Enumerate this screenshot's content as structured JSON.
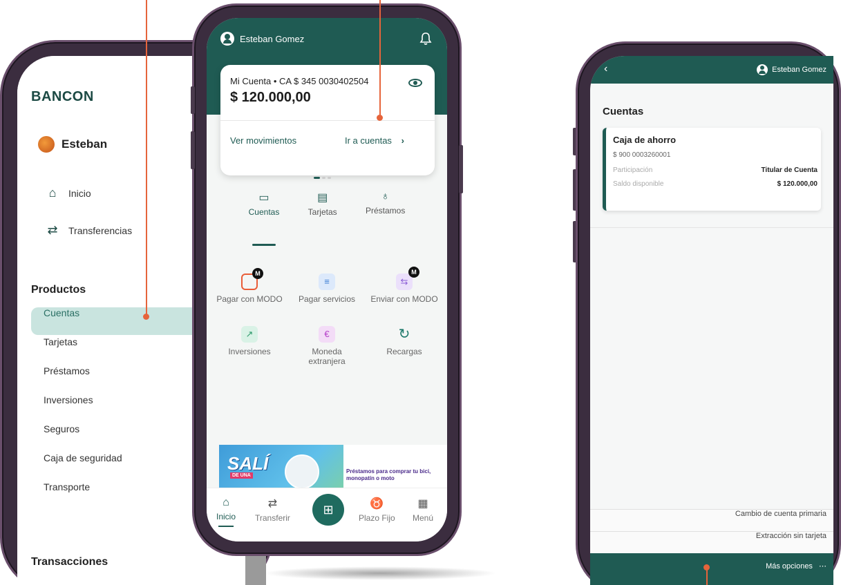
{
  "drawer": {
    "logo": "BANCON",
    "user_name": "Esteban",
    "nav": [
      {
        "label": "Inicio",
        "icon": "home-icon"
      },
      {
        "label": "Transferencias",
        "icon": "transfer-icon"
      }
    ],
    "products_title": "Productos",
    "products": [
      "Cuentas",
      "Tarjetas",
      "Préstamos",
      "Inversiones",
      "Seguros",
      "Caja de seguridad",
      "Transporte"
    ],
    "active_product": "Cuentas",
    "transactions_title": "Transacciones"
  },
  "home": {
    "user_name": "Esteban Gomez",
    "account_line": "Mi Cuenta • CA $ 345 0030402504",
    "balance": "$ 120.000,00",
    "link_movements": "Ver movimientos",
    "link_accounts": "Ir a cuentas",
    "tabs": [
      {
        "label": "Cuentas",
        "icon": "wallet-icon",
        "active": true
      },
      {
        "label": "Tarjetas",
        "icon": "card-icon",
        "active": false
      },
      {
        "label": "Préstamos",
        "icon": "money-bag-icon",
        "active": false
      }
    ],
    "quick_actions": [
      {
        "label": "Pagar con MODO",
        "badge": "M",
        "color": "#e95d38",
        "icon": "shopping-bag-icon"
      },
      {
        "label": "Pagar servicios",
        "badge": "",
        "color": "#3f7fd3",
        "icon": "receipt-icon"
      },
      {
        "label": "Enviar con MODO",
        "badge": "M",
        "color": "#8a5bd6",
        "icon": "send-money-icon"
      },
      {
        "label": "Inversiones",
        "badge": "",
        "color": "#2e9a6c",
        "icon": "chart-up-icon"
      },
      {
        "label": "Moneda extranjera",
        "badge": "",
        "color": "#b53fc9",
        "icon": "currency-exchange-icon"
      },
      {
        "label": "Recargas",
        "badge": "",
        "color": "#1f7a6c",
        "icon": "refresh-icon"
      }
    ],
    "banner": {
      "title": "SALÍ",
      "subtitle": "DE UNA",
      "text": "Préstamos para comprar tu bici, monopatín o moto"
    },
    "bottom_nav": [
      {
        "label": "Inicio",
        "icon": "home-icon",
        "active": true
      },
      {
        "label": "Transferir",
        "icon": "transfer-icon",
        "active": false
      },
      {
        "label": "Plazo Fijo",
        "icon": "piggy-bank-icon",
        "active": false
      },
      {
        "label": "Menú",
        "icon": "grid-icon",
        "active": false
      }
    ]
  },
  "cuentas": {
    "user_name": "Esteban Gomez",
    "title": "Cuentas",
    "account": {
      "name": "Caja de ahorro",
      "number": "$ 900 0003260001",
      "participation_label": "Participación",
      "participation_value": "Titular de Cuenta",
      "available_label": "Saldo disponible",
      "available_value": "$ 120.000,00"
    },
    "options": [
      "Cambio de cuenta primaria",
      "Extracción sin tarjeta"
    ],
    "more": "Más opciones"
  },
  "colors": {
    "brand": "#1f5b53",
    "callout": "#e6643b",
    "active_bg": "#c9e4df"
  }
}
